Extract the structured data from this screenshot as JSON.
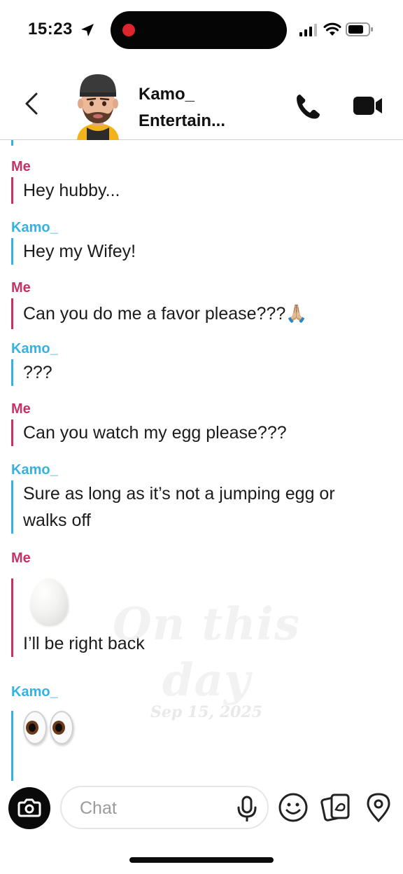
{
  "status_bar": {
    "time": "15:23"
  },
  "header": {
    "contact_name_line1": "Kamo_",
    "contact_name_line2": "Entertain..."
  },
  "messages": [
    {
      "sender": "Me",
      "text": "Hey hubby..."
    },
    {
      "sender": "Kamo_",
      "text": "Hey my Wifey!"
    },
    {
      "sender": "Me",
      "text": "Can you do me a favor please???",
      "emoji": "🙏🏼"
    },
    {
      "sender": "Kamo_",
      "text": "???"
    },
    {
      "sender": "Me",
      "text": "Can you watch my egg please???"
    },
    {
      "sender": "Kamo_",
      "text": "Sure as long as it’s not a jumping egg or walks off"
    },
    {
      "sender": "Me",
      "text": "I’ll be right back",
      "attachment": "egg"
    },
    {
      "sender": "Kamo_",
      "attachment": "eyes"
    }
  ],
  "watermark": {
    "title": "On this day",
    "date": "Sep 15, 2025"
  },
  "composer": {
    "placeholder": "Chat"
  },
  "icons": {
    "back": "chevron-left-icon",
    "call": "phone-icon",
    "video": "video-camera-icon",
    "camera": "camera-icon",
    "mic": "microphone-icon",
    "emoji": "smiley-icon",
    "cards": "sticker-cards-icon",
    "location": "location-pin-icon"
  },
  "colors": {
    "me": "#c93166",
    "friend": "#35b2e3"
  }
}
